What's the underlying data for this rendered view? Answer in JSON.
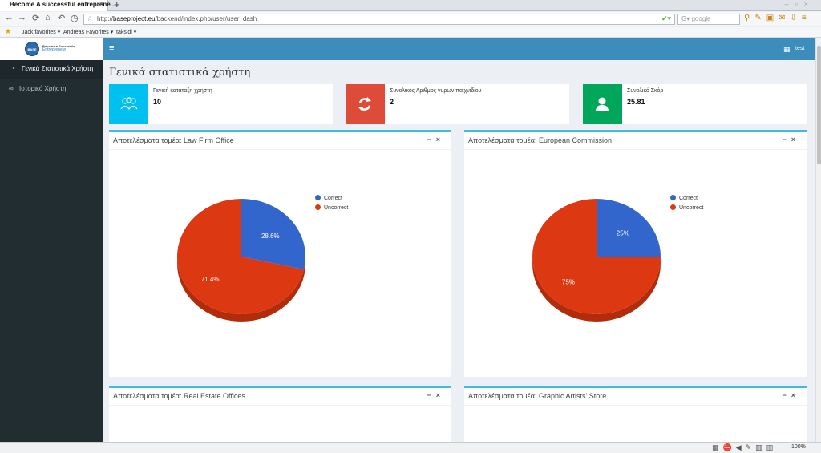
{
  "browser": {
    "tab_title": "Become A successful entreprene...",
    "tab_close": "×",
    "new_tab": "+",
    "url_host": "baseproject.eu",
    "url_prefix": "http://",
    "url_path": "/backend/index.php/user/user_dash",
    "search_placeholder": "google",
    "zoom": "100%",
    "bookmarks": [
      "Jack favorites",
      "Andreas Favorites",
      "taksidi"
    ]
  },
  "sidebar": {
    "logo": {
      "circle_text": "BASE",
      "title": "Become a Successful",
      "subtitle": "Entrepreneur"
    },
    "items": [
      {
        "label": "Γενικά Στατιστικά Χρήστη",
        "icon": "dashboard-icon",
        "active": true
      },
      {
        "label": "Ιστορικό Χρήστη",
        "icon": "link-icon",
        "active": false
      }
    ]
  },
  "topbar": {
    "username": "test"
  },
  "page": {
    "title": "Γενικά στατιστικά χρήστη"
  },
  "stats": [
    {
      "label": "Γενική καταταξη χρηστη",
      "value": "10",
      "color": "#00c0ef",
      "icon": "users-icon"
    },
    {
      "label": "Συνολικος Αριθμος γυρων παιχνιδιου",
      "value": "2",
      "color": "#dd4b39",
      "icon": "refresh-icon"
    },
    {
      "label": "Συνολικό Σκόρ",
      "value": "25.81",
      "color": "#00a65a",
      "icon": "user-icon"
    }
  ],
  "boxes": [
    {
      "title": "Αποτελέσματα τομέα: Law Firm Office",
      "legend": [
        "Correct",
        "Uncorrect"
      ],
      "chart": {
        "correct_pct": 28.6,
        "uncorrect_pct": 71.4,
        "correct_label": "28.6%",
        "uncorrect_label": "71.4%"
      }
    },
    {
      "title": "Αποτελέσματα τομέα: European Commission",
      "legend": [
        "Correct",
        "Uncorrect"
      ],
      "chart": {
        "correct_pct": 25,
        "uncorrect_pct": 75,
        "correct_label": "25%",
        "uncorrect_label": "75%"
      }
    },
    {
      "title": "Αποτελέσματα τομέα: Real Estate Offices"
    },
    {
      "title": "Αποτελέσματα τομέα: Graphic Artists' Store"
    }
  ],
  "box_tools": {
    "collapse": "−",
    "remove": "×"
  },
  "colors": {
    "correct": "#3366cc",
    "uncorrect": "#dc3912",
    "correct_side": "#2a54a8",
    "uncorrect_side": "#b22c0c",
    "box_border": "#3dbde0"
  }
}
